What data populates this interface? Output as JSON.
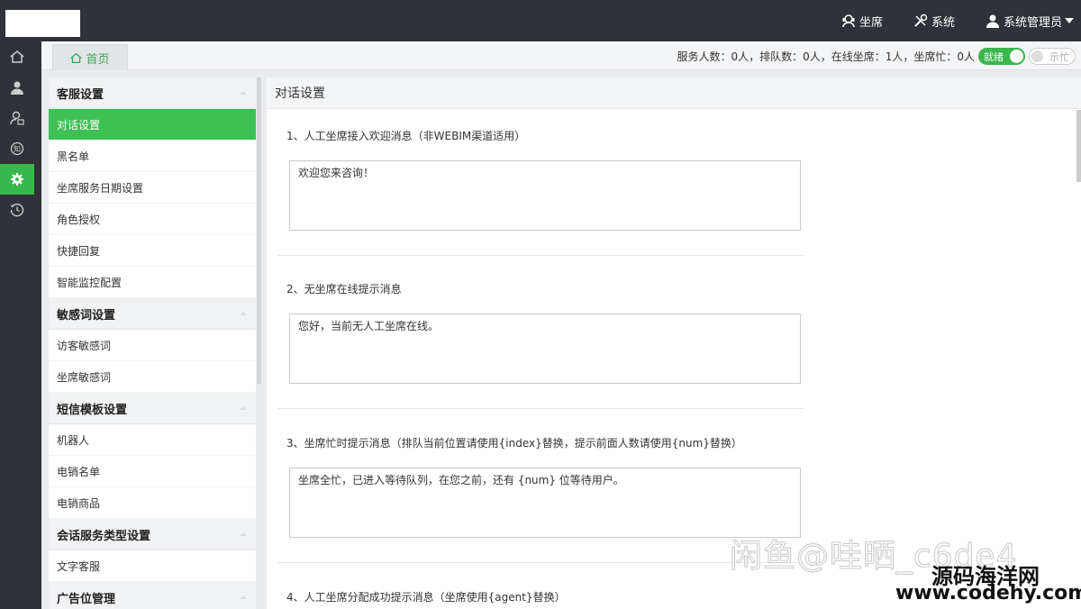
{
  "topbar": {
    "menu": [
      {
        "label": "坐席",
        "icon": "headset-icon"
      },
      {
        "label": "系统",
        "icon": "tools-icon"
      },
      {
        "label": "系统管理员",
        "icon": "user-icon"
      }
    ]
  },
  "rail": {
    "items": [
      {
        "icon": "home-icon"
      },
      {
        "icon": "user-icon"
      },
      {
        "icon": "agent-icon"
      },
      {
        "icon": "knowledge-icon"
      },
      {
        "icon": "settings-icon",
        "active": true
      },
      {
        "icon": "history-icon"
      }
    ]
  },
  "tabbar": {
    "home_tab": "首页",
    "stats": "服务人数：0人，排队数：0人，在线坐席：1人，坐席忙：0人",
    "ready_label": "就绪",
    "busy_label": "示忙"
  },
  "sidemenu": {
    "groups": [
      {
        "title": "客服设置",
        "items": [
          "对话设置",
          "黑名单",
          "坐席服务日期设置",
          "角色授权",
          "快捷回复",
          "智能监控配置"
        ]
      },
      {
        "title": "敏感词设置",
        "items": [
          "访客敏感词",
          "坐席敏感词"
        ]
      },
      {
        "title": "短信模板设置",
        "items": [
          "机器人",
          "电销名单",
          "电销商品"
        ]
      },
      {
        "title": "会话服务类型设置",
        "items": [
          "文字客服"
        ]
      },
      {
        "title": "广告位管理",
        "items": []
      }
    ],
    "active_item": "对话设置"
  },
  "panel": {
    "title": "对话设置",
    "sections": [
      {
        "label": "1、人工坐席接入欢迎消息（非WEBIM渠道适用）",
        "value": "欢迎您来咨询！"
      },
      {
        "label": "2、无坐席在线提示消息",
        "value": "您好，当前无人工坐席在线。"
      },
      {
        "label": "3、坐席忙时提示消息（排队当前位置请使用{index}替换，提示前面人数请使用{num}替换）",
        "value": "坐席全忙，已进入等待队列，在您之前，还有 {num} 位等待用户。"
      },
      {
        "label": "4、人工坐席分配成功提示消息（坐席使用{agent}替换）",
        "value": ""
      }
    ]
  },
  "watermark": {
    "line1": "闲鱼@哇晒_c6de4",
    "line2": "源码海洋网",
    "line3": "www.codehy.com"
  }
}
